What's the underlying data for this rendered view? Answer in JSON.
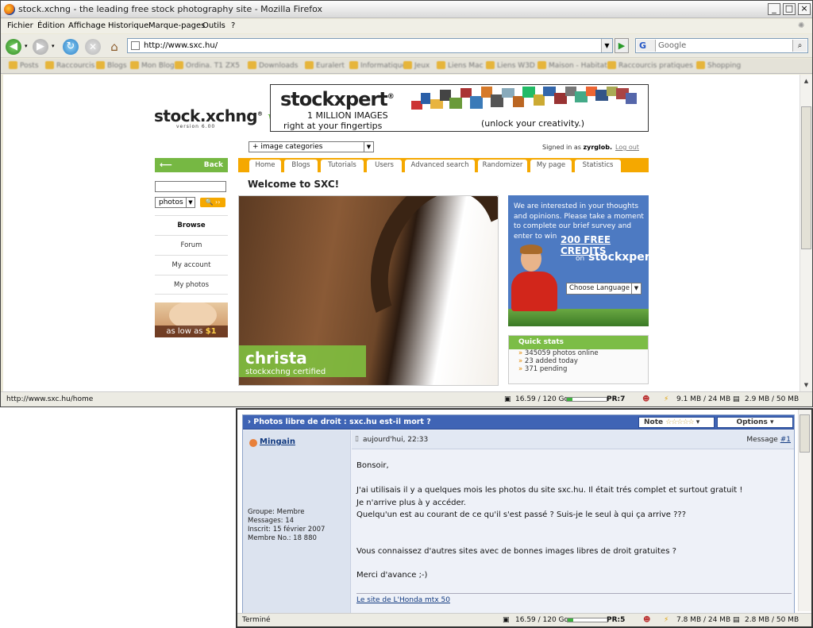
{
  "window": {
    "title": "stock.xchng - the leading free stock photography site - Mozilla Firefox"
  },
  "menu": [
    "Fichier",
    "Édition",
    "Affichage",
    "Historique",
    "Marque-pages",
    "Outils",
    "?"
  ],
  "toolbar": {
    "url": "http://www.sxc.hu/",
    "search_placeholder": "Google",
    "search_engine": "G"
  },
  "bookmarks": [
    "Posts",
    "Raccourcis",
    "Blogs",
    "Mon Blog",
    "Ordina. T1 ZX5",
    "Downloads",
    "Euralert",
    "Informatique",
    "Jeux",
    "Liens Mac",
    "Liens W3D",
    "Maison - Habitat",
    "Raccourcis pratiques",
    "Shopping"
  ],
  "page": {
    "logo_text": "stock.xchng",
    "logo_mark": "®",
    "logo_version_mark": "vi",
    "logo_sub": "version 6.00",
    "banner": {
      "brand": "stockxpert",
      "brand_mark": "®",
      "line1": "1 MILLION IMAGES",
      "line2": "right at your fingertips",
      "tagline": "(unlock your creativity.)"
    },
    "category_select": "+ image categories",
    "signed_in_prefix": "Signed in as",
    "signed_in_user": "zyrglob.",
    "logout": "Log out",
    "tabs": [
      "Home",
      "Blogs",
      "Tutorials",
      "Users",
      "Advanced search",
      "Randomizer",
      "My page",
      "Statistics"
    ],
    "welcome": "Welcome to SXC!",
    "back_arrow": "⟵",
    "back_label": "Back",
    "search_type": "photos",
    "go_icon": "🔍",
    "sidebar_links": [
      "Browse",
      "Forum",
      "My account",
      "My photos"
    ],
    "ad_text": "as low as",
    "ad_price": "$1",
    "feature_name": "christa",
    "feature_certified": "stockxchng certified",
    "survey": {
      "text": "We are interested in your thoughts and opinions. Please take a moment to complete our brief survey and enter to win",
      "credits": "200 FREE CREDITS",
      "on": "on",
      "brand": "stockxpert",
      "language": "Choose Language"
    },
    "quick_stats": {
      "title": "Quick stats",
      "bullet": "»",
      "items": [
        "345059 photos online",
        "23 added today",
        "371 pending"
      ]
    }
  },
  "status1": {
    "url": "http://www.sxc.hu/home",
    "disk": "16.59 / 120 Go",
    "disk_fraction": 0.14,
    "pagerank": "PR:7",
    "mem": "9.1 MB / 24 MB",
    "mem2": "2.9 MB / 50 MB"
  },
  "forum": {
    "title_bullet": "›",
    "title": "Photos libre de droit : sxc.hu est-il mort ?",
    "note_label": "Note",
    "note_stars": "☆☆☆☆☆",
    "options_label": "Options",
    "caret": "▾",
    "author": "Mingain",
    "group": "Groupe: Membre",
    "messages": "Messages: 14",
    "joined": "Inscrit: 15 février 2007",
    "member_no": "Membre No.: 18 880",
    "date": "aujourd'hui, 22:33",
    "message_label": "Message",
    "message_num": "#1",
    "lines": [
      "Bonsoir,",
      "J'ai utilisais il y a quelques mois les photos du site sxc.hu. Il était trés complet et surtout gratuit !",
      "Je n'arrive plus à y accéder.",
      "Quelqu'un est au courant de ce qu'il s'est passé ? Suis-je le seul à qui ça arrive ???",
      "Vous connaissez d'autres sites avec de bonnes images libres de droit gratuites ?",
      "Merci d'avance ;-)"
    ],
    "signature": "Le site de L'Honda mtx 50"
  },
  "status2": {
    "text": "Terminé",
    "disk": "16.59 / 120 Go",
    "pagerank": "PR:5",
    "mem": "7.8 MB / 24 MB",
    "mem2": "2.8 MB / 50 MB"
  },
  "colors": {
    "accent_green": "#76b843",
    "accent_orange": "#f5a800",
    "forum_blue": "#3f64b5"
  }
}
